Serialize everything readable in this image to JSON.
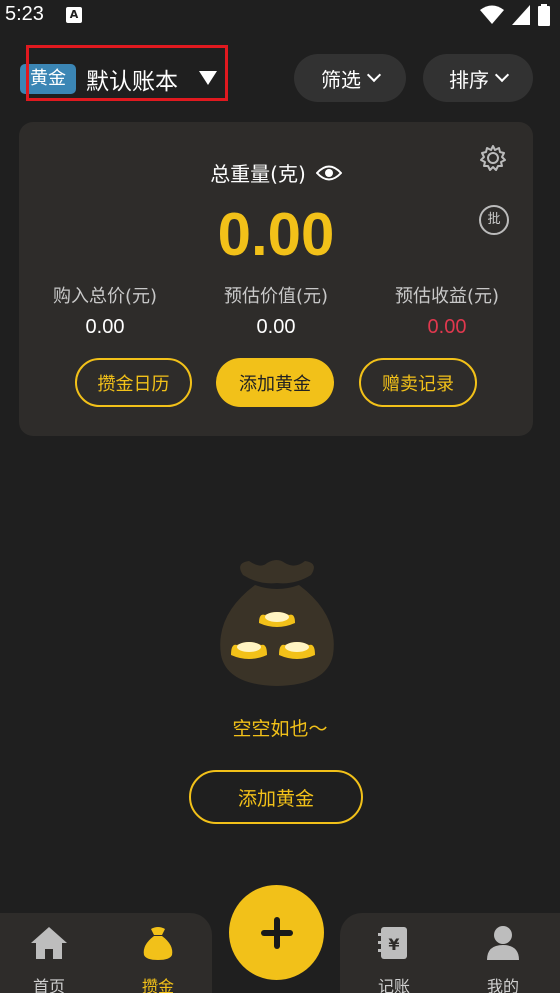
{
  "status_bar": {
    "time": "5:23",
    "app_icon_letter": "A"
  },
  "header": {
    "book_tag": "黄金",
    "book_name": "默认账本",
    "filter_label": "筛选",
    "sort_label": "排序"
  },
  "summary": {
    "total_weight_label": "总重量(克)",
    "total_weight_value": "0.00",
    "batch_label": "批",
    "stats": [
      {
        "label": "购入总价(元)",
        "value": "0.00"
      },
      {
        "label": "预估价值(元)",
        "value": "0.00"
      },
      {
        "label": "预估收益(元)",
        "value": "0.00"
      }
    ],
    "buttons": {
      "calendar": "攒金日历",
      "add": "添加黄金",
      "records": "赠卖记录"
    }
  },
  "empty_state": {
    "text": "空空如也～",
    "add_button": "添加黄金"
  },
  "bottom_nav": [
    {
      "label": "首页",
      "icon": "home-icon"
    },
    {
      "label": "攒金",
      "icon": "money-bag-icon",
      "active": true
    },
    {
      "label": "记账",
      "icon": "ledger-icon"
    },
    {
      "label": "我的",
      "icon": "user-icon"
    }
  ],
  "colors": {
    "accent": "#f2c119",
    "background": "#1f1f1f",
    "card": "#2e2c2a",
    "tag_blue": "#3b86b5",
    "highlight_red": "#e0191f",
    "income_red": "#e0384e"
  }
}
